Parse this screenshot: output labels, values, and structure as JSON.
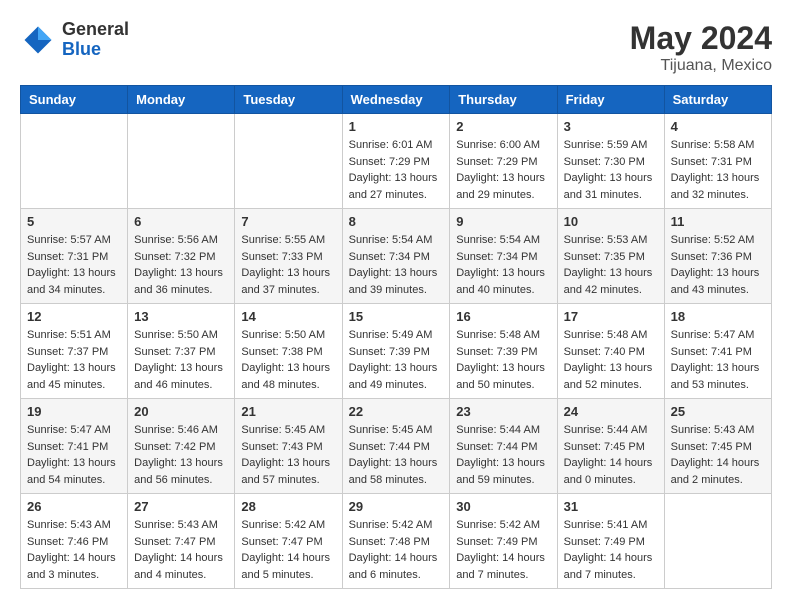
{
  "header": {
    "logo_general": "General",
    "logo_blue": "Blue",
    "month_year": "May 2024",
    "location": "Tijuana, Mexico"
  },
  "weekdays": [
    "Sunday",
    "Monday",
    "Tuesday",
    "Wednesday",
    "Thursday",
    "Friday",
    "Saturday"
  ],
  "weeks": [
    [
      {
        "day": "",
        "sunrise": "",
        "sunset": "",
        "daylight": ""
      },
      {
        "day": "",
        "sunrise": "",
        "sunset": "",
        "daylight": ""
      },
      {
        "day": "",
        "sunrise": "",
        "sunset": "",
        "daylight": ""
      },
      {
        "day": "1",
        "sunrise": "Sunrise: 6:01 AM",
        "sunset": "Sunset: 7:29 PM",
        "daylight": "Daylight: 13 hours and 27 minutes."
      },
      {
        "day": "2",
        "sunrise": "Sunrise: 6:00 AM",
        "sunset": "Sunset: 7:29 PM",
        "daylight": "Daylight: 13 hours and 29 minutes."
      },
      {
        "day": "3",
        "sunrise": "Sunrise: 5:59 AM",
        "sunset": "Sunset: 7:30 PM",
        "daylight": "Daylight: 13 hours and 31 minutes."
      },
      {
        "day": "4",
        "sunrise": "Sunrise: 5:58 AM",
        "sunset": "Sunset: 7:31 PM",
        "daylight": "Daylight: 13 hours and 32 minutes."
      }
    ],
    [
      {
        "day": "5",
        "sunrise": "Sunrise: 5:57 AM",
        "sunset": "Sunset: 7:31 PM",
        "daylight": "Daylight: 13 hours and 34 minutes."
      },
      {
        "day": "6",
        "sunrise": "Sunrise: 5:56 AM",
        "sunset": "Sunset: 7:32 PM",
        "daylight": "Daylight: 13 hours and 36 minutes."
      },
      {
        "day": "7",
        "sunrise": "Sunrise: 5:55 AM",
        "sunset": "Sunset: 7:33 PM",
        "daylight": "Daylight: 13 hours and 37 minutes."
      },
      {
        "day": "8",
        "sunrise": "Sunrise: 5:54 AM",
        "sunset": "Sunset: 7:34 PM",
        "daylight": "Daylight: 13 hours and 39 minutes."
      },
      {
        "day": "9",
        "sunrise": "Sunrise: 5:54 AM",
        "sunset": "Sunset: 7:34 PM",
        "daylight": "Daylight: 13 hours and 40 minutes."
      },
      {
        "day": "10",
        "sunrise": "Sunrise: 5:53 AM",
        "sunset": "Sunset: 7:35 PM",
        "daylight": "Daylight: 13 hours and 42 minutes."
      },
      {
        "day": "11",
        "sunrise": "Sunrise: 5:52 AM",
        "sunset": "Sunset: 7:36 PM",
        "daylight": "Daylight: 13 hours and 43 minutes."
      }
    ],
    [
      {
        "day": "12",
        "sunrise": "Sunrise: 5:51 AM",
        "sunset": "Sunset: 7:37 PM",
        "daylight": "Daylight: 13 hours and 45 minutes."
      },
      {
        "day": "13",
        "sunrise": "Sunrise: 5:50 AM",
        "sunset": "Sunset: 7:37 PM",
        "daylight": "Daylight: 13 hours and 46 minutes."
      },
      {
        "day": "14",
        "sunrise": "Sunrise: 5:50 AM",
        "sunset": "Sunset: 7:38 PM",
        "daylight": "Daylight: 13 hours and 48 minutes."
      },
      {
        "day": "15",
        "sunrise": "Sunrise: 5:49 AM",
        "sunset": "Sunset: 7:39 PM",
        "daylight": "Daylight: 13 hours and 49 minutes."
      },
      {
        "day": "16",
        "sunrise": "Sunrise: 5:48 AM",
        "sunset": "Sunset: 7:39 PM",
        "daylight": "Daylight: 13 hours and 50 minutes."
      },
      {
        "day": "17",
        "sunrise": "Sunrise: 5:48 AM",
        "sunset": "Sunset: 7:40 PM",
        "daylight": "Daylight: 13 hours and 52 minutes."
      },
      {
        "day": "18",
        "sunrise": "Sunrise: 5:47 AM",
        "sunset": "Sunset: 7:41 PM",
        "daylight": "Daylight: 13 hours and 53 minutes."
      }
    ],
    [
      {
        "day": "19",
        "sunrise": "Sunrise: 5:47 AM",
        "sunset": "Sunset: 7:41 PM",
        "daylight": "Daylight: 13 hours and 54 minutes."
      },
      {
        "day": "20",
        "sunrise": "Sunrise: 5:46 AM",
        "sunset": "Sunset: 7:42 PM",
        "daylight": "Daylight: 13 hours and 56 minutes."
      },
      {
        "day": "21",
        "sunrise": "Sunrise: 5:45 AM",
        "sunset": "Sunset: 7:43 PM",
        "daylight": "Daylight: 13 hours and 57 minutes."
      },
      {
        "day": "22",
        "sunrise": "Sunrise: 5:45 AM",
        "sunset": "Sunset: 7:44 PM",
        "daylight": "Daylight: 13 hours and 58 minutes."
      },
      {
        "day": "23",
        "sunrise": "Sunrise: 5:44 AM",
        "sunset": "Sunset: 7:44 PM",
        "daylight": "Daylight: 13 hours and 59 minutes."
      },
      {
        "day": "24",
        "sunrise": "Sunrise: 5:44 AM",
        "sunset": "Sunset: 7:45 PM",
        "daylight": "Daylight: 14 hours and 0 minutes."
      },
      {
        "day": "25",
        "sunrise": "Sunrise: 5:43 AM",
        "sunset": "Sunset: 7:45 PM",
        "daylight": "Daylight: 14 hours and 2 minutes."
      }
    ],
    [
      {
        "day": "26",
        "sunrise": "Sunrise: 5:43 AM",
        "sunset": "Sunset: 7:46 PM",
        "daylight": "Daylight: 14 hours and 3 minutes."
      },
      {
        "day": "27",
        "sunrise": "Sunrise: 5:43 AM",
        "sunset": "Sunset: 7:47 PM",
        "daylight": "Daylight: 14 hours and 4 minutes."
      },
      {
        "day": "28",
        "sunrise": "Sunrise: 5:42 AM",
        "sunset": "Sunset: 7:47 PM",
        "daylight": "Daylight: 14 hours and 5 minutes."
      },
      {
        "day": "29",
        "sunrise": "Sunrise: 5:42 AM",
        "sunset": "Sunset: 7:48 PM",
        "daylight": "Daylight: 14 hours and 6 minutes."
      },
      {
        "day": "30",
        "sunrise": "Sunrise: 5:42 AM",
        "sunset": "Sunset: 7:49 PM",
        "daylight": "Daylight: 14 hours and 7 minutes."
      },
      {
        "day": "31",
        "sunrise": "Sunrise: 5:41 AM",
        "sunset": "Sunset: 7:49 PM",
        "daylight": "Daylight: 14 hours and 7 minutes."
      },
      {
        "day": "",
        "sunrise": "",
        "sunset": "",
        "daylight": ""
      }
    ]
  ]
}
